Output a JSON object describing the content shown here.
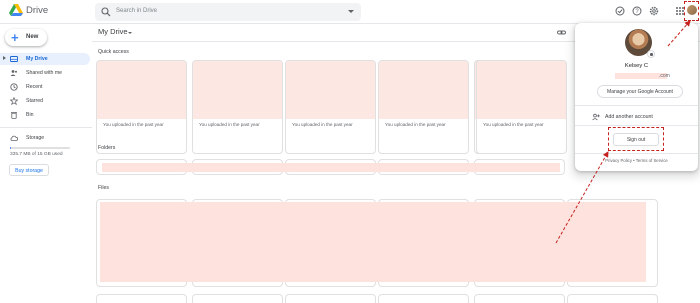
{
  "header": {
    "app_title": "Drive",
    "search_placeholder": "Search in Drive"
  },
  "sidebar": {
    "new_label": "New",
    "items": [
      {
        "label": "My Drive",
        "icon": "my-drive-icon",
        "active": true
      },
      {
        "label": "Shared with me",
        "icon": "shared-icon"
      },
      {
        "label": "Recent",
        "icon": "recent-icon"
      },
      {
        "label": "Starred",
        "icon": "star-icon"
      },
      {
        "label": "Bin",
        "icon": "trash-icon"
      }
    ],
    "storage_label": "Storage",
    "storage_used_text": "335.7 MB of 15 GB used",
    "storage_fraction": 0.02,
    "buy_storage_label": "Buy storage"
  },
  "main": {
    "title": "My Drive",
    "quick_access_label": "Quick access",
    "quick_access_subtitle": "You uploaded in the past year",
    "folders_label": "Folders",
    "files_label": "Files"
  },
  "account_popup": {
    "name": "Kelsey C",
    "email_suffix": ".com",
    "manage_label": "Manage your Google Account",
    "add_account_label": "Add another account",
    "sign_out_label": "Sign out",
    "footer": "Privacy Policy  •  Terms of Service"
  },
  "colors": {
    "accent": "#1a73e8",
    "annotation": "#c5221f",
    "redaction": "#fde2de"
  }
}
